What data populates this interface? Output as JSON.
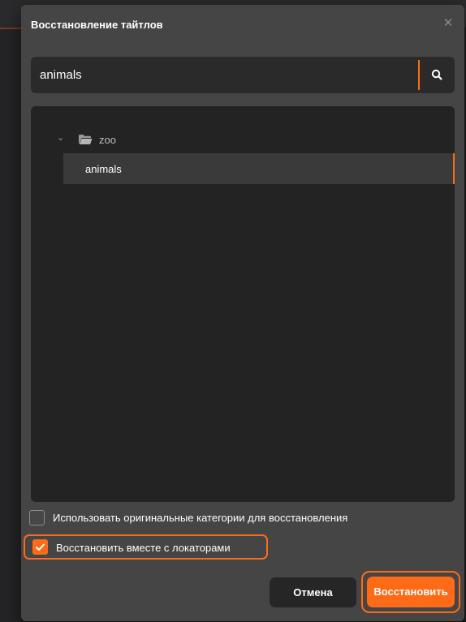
{
  "dialog": {
    "title": "Восстановление тайтлов",
    "close_icon": "close-icon"
  },
  "search": {
    "value": "animals",
    "placeholder": "",
    "icon": "search-icon"
  },
  "tree": {
    "folder": {
      "label": "zoo",
      "expanded": true,
      "icon": "folder-open-icon"
    },
    "items": [
      {
        "label": "animals",
        "selected": true
      }
    ]
  },
  "options": [
    {
      "label": "Использовать оригинальные категории для восстановления",
      "checked": false
    },
    {
      "label": "Восстановить вместе с локаторами",
      "checked": true
    }
  ],
  "buttons": {
    "cancel": "Отмена",
    "restore": "Восстановить"
  },
  "colors": {
    "accent": "#ff6a17",
    "dialog_bg": "#454545",
    "panel_bg": "#232323"
  }
}
